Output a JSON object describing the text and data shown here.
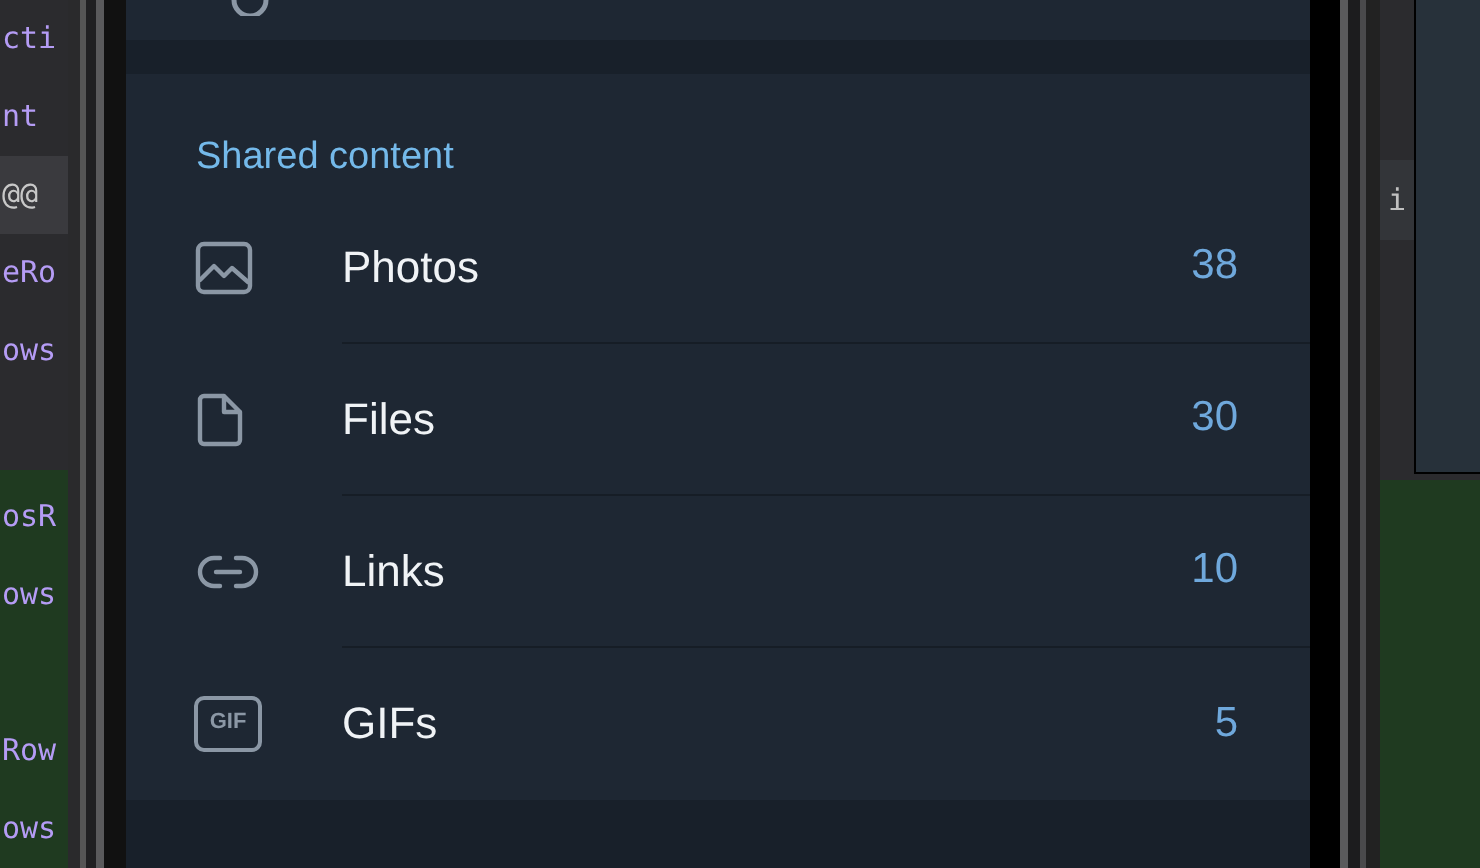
{
  "editor_left": {
    "lines": [
      {
        "kind": "plain",
        "text": "cti"
      },
      {
        "kind": "plain",
        "text": "nt"
      },
      {
        "kind": "highlighted",
        "text": "@@"
      },
      {
        "kind": "plain",
        "text": "eRo"
      },
      {
        "kind": "plain",
        "text": "ows"
      }
    ],
    "diff_lines": [
      {
        "kind": "plain",
        "text": "osR"
      },
      {
        "kind": "plain",
        "text": "ows"
      },
      {
        "kind": "after_blank",
        "text": "Row"
      },
      {
        "kind": "plain",
        "text": "ows"
      }
    ]
  },
  "editor_right": {
    "marker": "i"
  },
  "shared_content": {
    "title": "Shared content",
    "items": [
      {
        "kind": "photos",
        "label": "Photos",
        "count": "38"
      },
      {
        "kind": "files",
        "label": "Files",
        "count": "30"
      },
      {
        "kind": "links",
        "label": "Links",
        "count": "10"
      },
      {
        "kind": "gifs",
        "icon_text": "GIF",
        "label": "GIFs",
        "count": "5"
      }
    ]
  }
}
